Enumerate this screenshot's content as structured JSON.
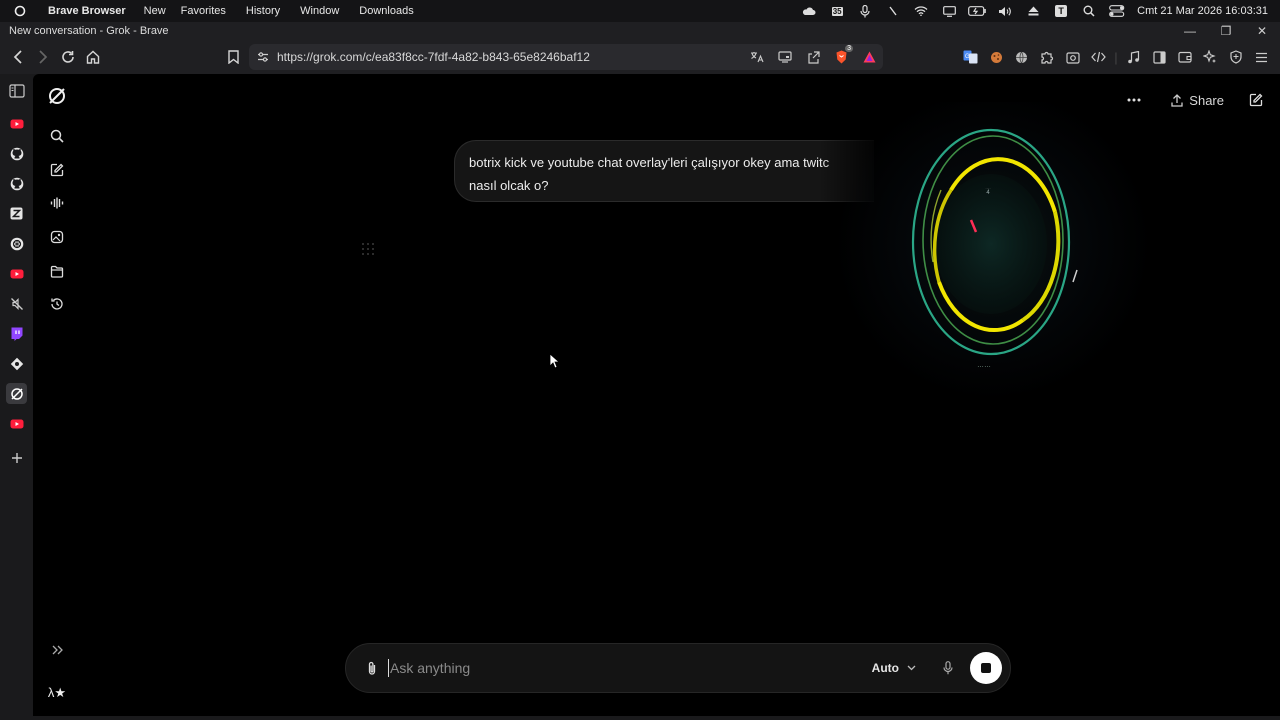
{
  "menubar": {
    "app_name": "Brave Browser",
    "items": [
      "New",
      "Favorites",
      "History",
      "Window",
      "Downloads"
    ],
    "calendar_day": "35",
    "clock": "Cmt 21 Mar 2026  16:03:31"
  },
  "window": {
    "title": "New conversation - Grok - Brave"
  },
  "toolbar": {
    "url": "https://grok.com/c/ea83f8cc-7fdf-4a82-b843-65e8246baf12",
    "brave_shield_count": "3"
  },
  "header": {
    "share_label": "Share"
  },
  "conversation": {
    "user_message_line1": "botrix kick ve youtube chat overlay'leri çalışıyor okey ama twitc",
    "user_message_line2": "nasıl olcak o?"
  },
  "overlay": {
    "top_label": "4",
    "bottom_label": "……"
  },
  "composer": {
    "placeholder": "Ask anything",
    "value": "",
    "model": "Auto"
  },
  "sidebar": {
    "avatar_label": "λ★"
  },
  "colors": {
    "page_bg": "#000000",
    "chrome_bg": "#1f1f22",
    "ring_yellow": "#f2e600",
    "ring_teal": "#2fb893",
    "accent_red": "#ff2d55"
  }
}
